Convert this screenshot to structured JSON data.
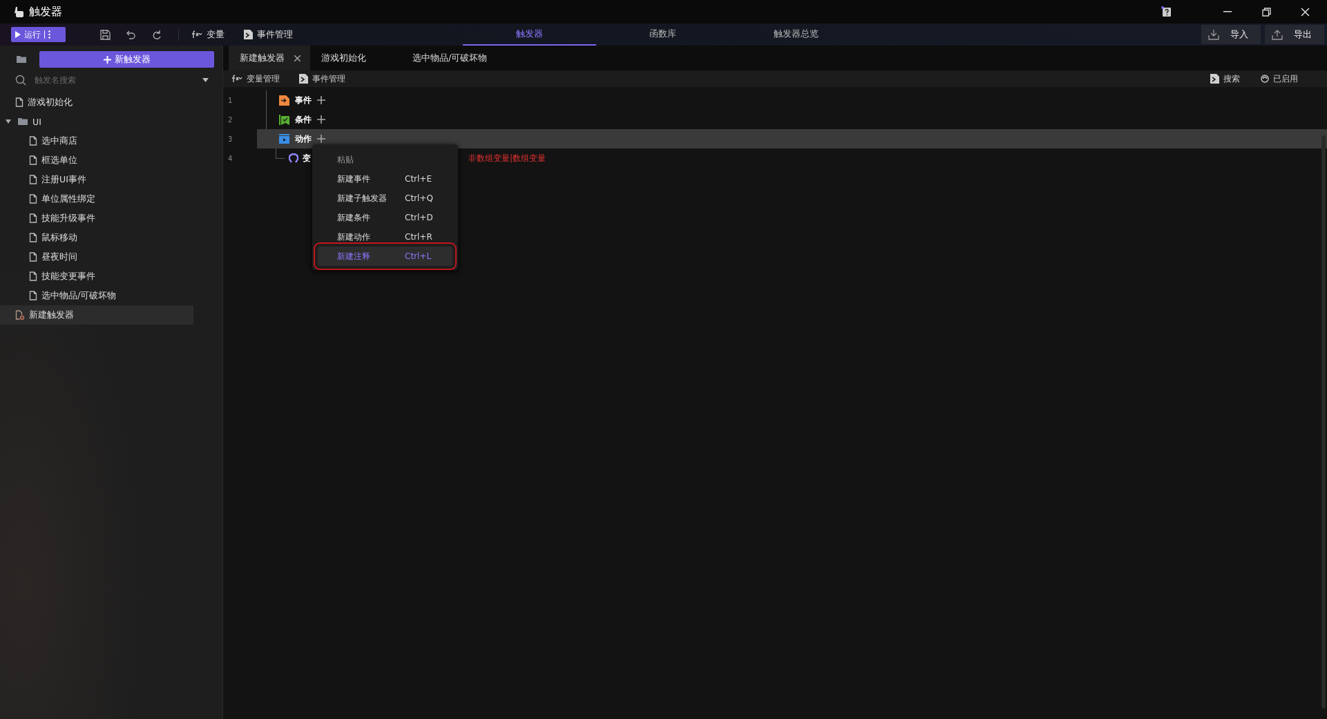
{
  "window": {
    "title": "触发器"
  },
  "toolbar": {
    "run_button": "运行",
    "items": [
      {
        "label": "变量",
        "kind": "fx"
      },
      {
        "label": "事件管理",
        "kind": "doc"
      }
    ]
  },
  "main_tabs": [
    {
      "label": "触发器",
      "selected": true
    },
    {
      "label": "函数库",
      "selected": false
    },
    {
      "label": "触发器总览",
      "selected": false
    }
  ],
  "actions": [
    {
      "label": "导入",
      "kind": "import"
    },
    {
      "label": "导出",
      "kind": "export"
    }
  ],
  "sidebar": {
    "new_button": "新触发器",
    "search": {
      "placeholder": "触发名搜索"
    },
    "tree": [
      {
        "label": "游戏初始化",
        "kind": "file",
        "selected": false
      },
      {
        "label": "UI",
        "kind": "folder",
        "expanded": true,
        "selected": false,
        "children": [
          {
            "label": "选中商店",
            "kind": "file",
            "selected": false
          },
          {
            "label": "框选单位",
            "kind": "file",
            "selected": false
          },
          {
            "label": "注册UI事件",
            "kind": "file",
            "selected": false
          },
          {
            "label": "单位属性绑定",
            "kind": "file",
            "selected": false
          },
          {
            "label": "技能升级事件",
            "kind": "file",
            "selected": false
          },
          {
            "label": "鼠标移动",
            "kind": "file",
            "selected": false
          },
          {
            "label": "昼夜时间",
            "kind": "file",
            "selected": false
          },
          {
            "label": "技能变更事件",
            "kind": "file",
            "selected": false
          },
          {
            "label": "选中物品/可破坏物",
            "kind": "file",
            "selected": false
          }
        ]
      },
      {
        "label": "新建触发器",
        "kind": "error",
        "selected": true
      }
    ]
  },
  "editor_tabs": [
    {
      "label": "新建触发器",
      "selected": true,
      "closable": true
    },
    {
      "label": "游戏初始化",
      "selected": false,
      "closable": false
    },
    {
      "label": "选中物品/可破坏物",
      "selected": false,
      "closable": false
    }
  ],
  "sub_toolbar": {
    "left": [
      {
        "label": "变量管理",
        "kind": "fx"
      },
      {
        "label": "事件管理",
        "kind": "doc"
      }
    ],
    "right": [
      {
        "label": "搜索",
        "kind": "doc"
      },
      {
        "label": "已启用",
        "kind": "toggle"
      }
    ]
  },
  "lines": [
    {
      "number": "1",
      "label": "事件",
      "kind": "event",
      "selected": false
    },
    {
      "number": "2",
      "label": "条件",
      "kind": "condition",
      "selected": false
    },
    {
      "number": "3",
      "label": "动作",
      "kind": "action",
      "selected": true,
      "children": [
        {
          "number": "4",
          "label": "变",
          "kind": "variable",
          "selected": false,
          "note": "非数组变量|数组变量"
        }
      ]
    }
  ],
  "context_menu": {
    "items": [
      {
        "label": "粘贴",
        "disabled": true,
        "selected": false
      },
      {
        "label": "新建事件",
        "shortcut": "Ctrl+E",
        "disabled": false,
        "selected": false
      },
      {
        "label": "新建子触发器",
        "shortcut": "Ctrl+Q",
        "disabled": false,
        "selected": false
      },
      {
        "label": "新建条件",
        "shortcut": "Ctrl+D",
        "disabled": false,
        "selected": false
      },
      {
        "label": "新建动作",
        "shortcut": "Ctrl+R",
        "disabled": false,
        "selected": false
      },
      {
        "label": "新建注释",
        "shortcut": "Ctrl+L",
        "disabled": false,
        "selected": true
      }
    ]
  }
}
